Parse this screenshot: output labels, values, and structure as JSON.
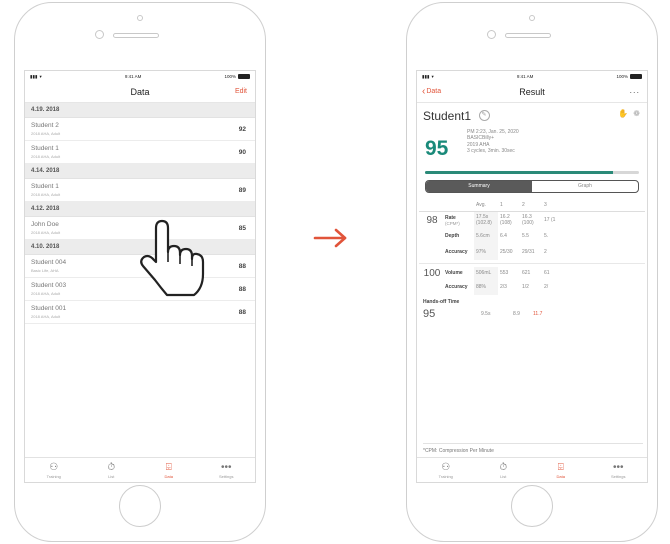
{
  "left_screen": {
    "status": {
      "time": "9:41 AM",
      "battery": "100%"
    },
    "title": "Data",
    "edit_label": "Edit",
    "sections": [
      {
        "date": "4.19. 2018",
        "rows": [
          {
            "name": "Student 2",
            "sub": "2018 AHA, Adult",
            "score": "92"
          },
          {
            "name": "Student 1",
            "sub": "2018 AHA, Adult",
            "score": "90"
          }
        ]
      },
      {
        "date": "4.14. 2018",
        "rows": [
          {
            "name": "Student 1",
            "sub": "2018 AHA, Adult",
            "score": "89"
          }
        ]
      },
      {
        "date": "4.12. 2018",
        "rows": [
          {
            "name": "John Doe",
            "sub": "2018 AHA, Adult",
            "score": "85"
          }
        ]
      },
      {
        "date": "4.10. 2018",
        "rows": [
          {
            "name": "Student 004",
            "sub": "Basic Life, AHA",
            "score": "88"
          },
          {
            "name": "Student 003",
            "sub": "2018 AHA, Adult",
            "score": "88"
          },
          {
            "name": "Student 001",
            "sub": "2018 AHA, Adult",
            "score": "88"
          }
        ]
      }
    ],
    "tabs": [
      {
        "label": "Training",
        "icon": "people-icon",
        "glyph": "⚇"
      },
      {
        "label": "List",
        "icon": "stopwatch-icon",
        "glyph": "⏱"
      },
      {
        "label": "Data",
        "icon": "data-icon",
        "glyph": "⌹",
        "active": true
      },
      {
        "label": "Settings",
        "icon": "more-icon",
        "glyph": "•••"
      }
    ]
  },
  "right_screen": {
    "status": {
      "time": "9:41 AM",
      "battery": "100%"
    },
    "back_label": "Data",
    "title": "Result",
    "more_label": "...",
    "student_name": "Student1",
    "score": "95",
    "meta": [
      "PM 2:23, Jan. 25, 2020",
      "BASICBilly+",
      "2019 AHA",
      "3 cycles, 3min. 30sec"
    ],
    "progress": 0.88,
    "segments": [
      "Summary",
      "Graph"
    ],
    "table": {
      "headers": [
        "Avg.",
        "1",
        "2",
        "3"
      ],
      "rows": [
        {
          "score": "98",
          "label": "Rate",
          "unit": "(CPM*)",
          "avg": "17.5s (102.8)",
          "v1": "16.2 (108)",
          "v2": "16.3 (100)",
          "v3": "17 (1"
        },
        {
          "score": "",
          "label": "Depth",
          "unit": "",
          "avg": "5.6cm",
          "v1": "6.4",
          "v2": "5.5",
          "v3": "5."
        },
        {
          "score": "",
          "label": "Accuracy",
          "unit": "",
          "avg": "97%",
          "v1": "25/30",
          "v2": "29/31",
          "v3": "2"
        },
        {
          "score": "100",
          "label": "Volume",
          "unit": "",
          "avg": "506mL",
          "v1": "553",
          "v2": "621",
          "v3": "61"
        },
        {
          "score": "",
          "label": "Accuracy",
          "unit": "",
          "avg": "88%",
          "v1": "2/3",
          "v2": "1/2",
          "v3": "2/"
        }
      ]
    },
    "hands_off": {
      "label": "Hands-off Time",
      "score": "95",
      "avg": "9.5s",
      "v2": "8.9",
      "v3": "11.7"
    },
    "footnote": "*CPM: Compression Per Minute",
    "colors": {
      "accent": "#e1543a",
      "score": "#1a8a7a"
    }
  }
}
